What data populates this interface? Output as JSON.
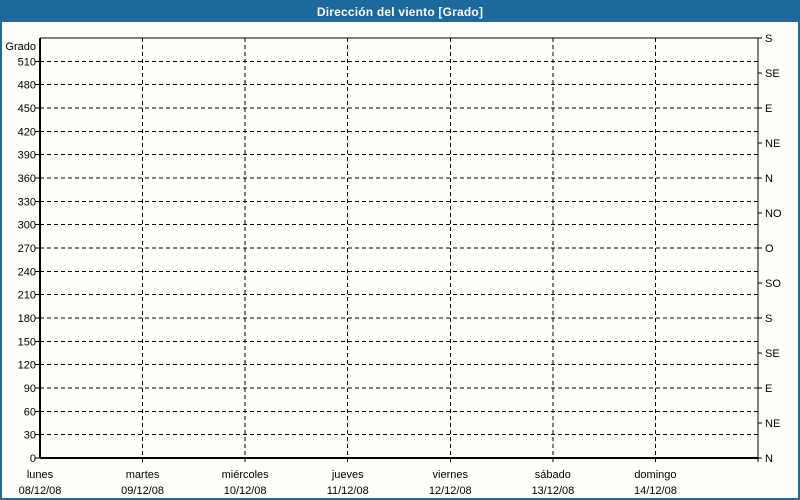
{
  "window": {
    "title": "Dirección del viento [Grado]"
  },
  "colors": {
    "titlebar_bg": "#1E699B",
    "titlebar_text": "#FFFFFF",
    "frame_border": "#1E699B",
    "chart_bg": "#FEFEFA",
    "grid_line": "#000000",
    "axis_line": "#000000",
    "label_text": "#000000"
  },
  "chart_data": {
    "type": "line",
    "title": "Dirección del viento [Grado]",
    "ylabel": "Grado",
    "ylim": [
      0,
      540
    ],
    "ytick_step": 30,
    "y_left_ticks": [
      0,
      30,
      60,
      90,
      120,
      150,
      180,
      210,
      240,
      270,
      300,
      330,
      360,
      390,
      420,
      450,
      480,
      510
    ],
    "y_right_ticks": [
      {
        "deg": 0,
        "label": "N"
      },
      {
        "deg": 45,
        "label": "NE"
      },
      {
        "deg": 90,
        "label": "E"
      },
      {
        "deg": 135,
        "label": "SE"
      },
      {
        "deg": 180,
        "label": "S"
      },
      {
        "deg": 225,
        "label": "SO"
      },
      {
        "deg": 270,
        "label": "O"
      },
      {
        "deg": 315,
        "label": "NO"
      },
      {
        "deg": 360,
        "label": "N"
      },
      {
        "deg": 405,
        "label": "NE"
      },
      {
        "deg": 450,
        "label": "E"
      },
      {
        "deg": 495,
        "label": "SE"
      },
      {
        "deg": 540,
        "label": "S"
      }
    ],
    "x_categories": [
      {
        "day": "lunes",
        "date": "08/12/08"
      },
      {
        "day": "martes",
        "date": "09/12/08"
      },
      {
        "day": "miércoles",
        "date": "10/12/08"
      },
      {
        "day": "jueves",
        "date": "11/12/08"
      },
      {
        "day": "viernes",
        "date": "12/12/08"
      },
      {
        "day": "sábado",
        "date": "13/12/08"
      },
      {
        "day": "domingo",
        "date": "14/12/08"
      }
    ],
    "series": [],
    "grid": "dashed-both-directions",
    "legend": "none"
  }
}
